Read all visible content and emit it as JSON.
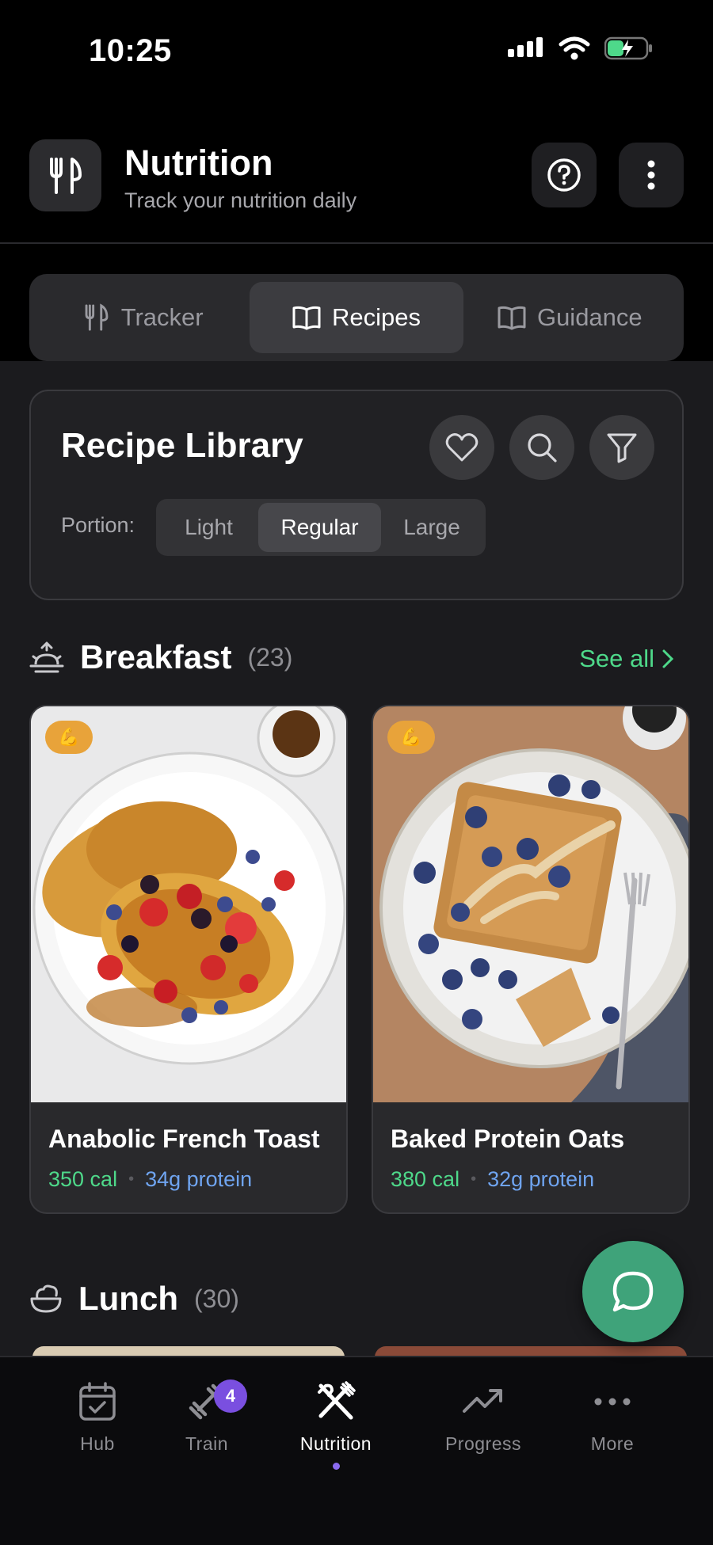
{
  "status_bar": {
    "time": "10:25"
  },
  "header": {
    "title": "Nutrition",
    "subtitle": "Track your nutrition daily"
  },
  "tabs": [
    {
      "label": "Tracker",
      "icon": "utensils-icon",
      "active": false
    },
    {
      "label": "Recipes",
      "icon": "book-icon",
      "active": true
    },
    {
      "label": "Guidance",
      "icon": "book-icon",
      "active": false
    }
  ],
  "library": {
    "title": "Recipe Library",
    "portion_label": "Portion:",
    "portions": [
      "Light",
      "Regular",
      "Large"
    ],
    "selected_portion": "Regular"
  },
  "breakfast": {
    "title": "Breakfast",
    "count": "(23)",
    "see_all": "See all",
    "recipes": [
      {
        "name": "Anabolic French Toast",
        "calories": "350 cal",
        "protein": "34g protein"
      },
      {
        "name": "Baked Protein Oats",
        "calories": "380 cal",
        "protein": "32g protein"
      }
    ]
  },
  "lunch": {
    "title": "Lunch",
    "count": "(30)"
  },
  "bottom_nav": {
    "items": [
      {
        "label": "Hub"
      },
      {
        "label": "Train",
        "badge": "4"
      },
      {
        "label": "Nutrition",
        "active": true
      },
      {
        "label": "Progress"
      },
      {
        "label": "More"
      }
    ]
  },
  "colors": {
    "accent_green": "#4ed98a",
    "protein_blue": "#6fa4f0",
    "nav_badge": "#7a4fe0",
    "fab": "#3fa37a"
  }
}
